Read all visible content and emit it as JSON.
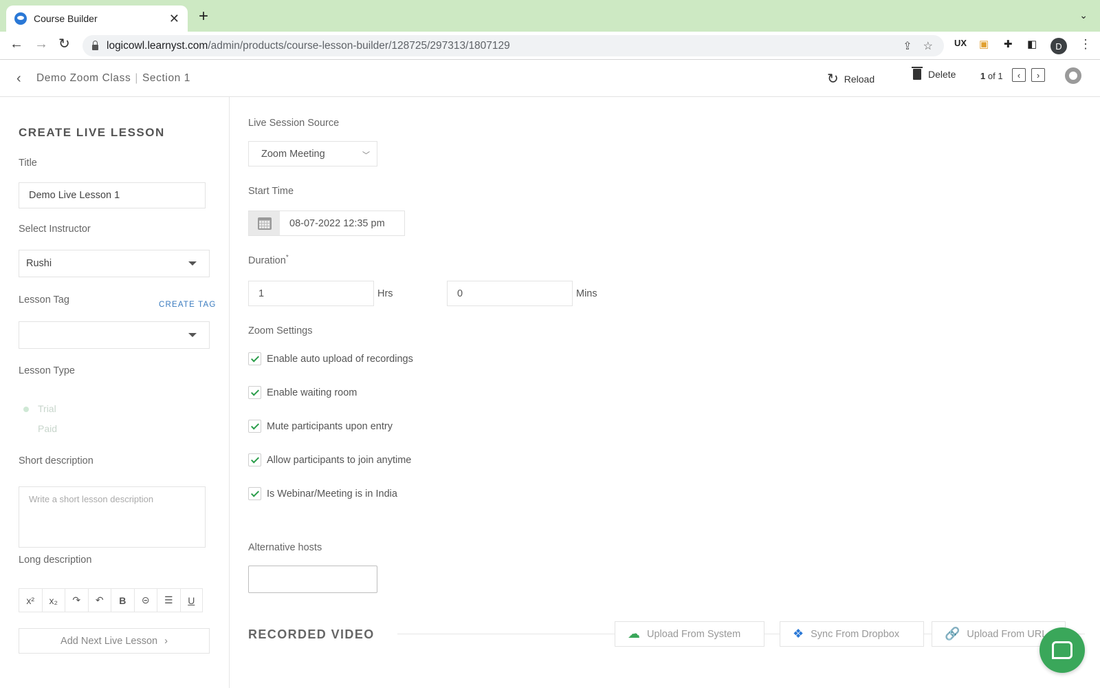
{
  "browser": {
    "tab_title": "Course Builder",
    "url_host": "logicowl.learnyst.com",
    "url_path": "/admin/products/course-lesson-builder/128725/297313/1807129",
    "profile_initial": "D",
    "ext_ux": "UX"
  },
  "header": {
    "course": "Demo Zoom Class",
    "section": "Section 1",
    "reload_label": "Reload",
    "delete_label": "Delete",
    "page_current": "1",
    "page_total": "of 1"
  },
  "left": {
    "panel_title": "CREATE LIVE LESSON",
    "title_label": "Title",
    "title_value": "Demo Live Lesson 1",
    "instructor_label": "Select Instructor",
    "instructor_value": "Rushi",
    "tag_label": "Lesson Tag",
    "create_tag": "CREATE TAG",
    "tag_value": "",
    "type_label": "Lesson Type",
    "type_options": [
      "Trial",
      "Paid"
    ],
    "short_desc_label": "Short description",
    "short_desc_placeholder": "Write a short lesson description",
    "long_desc_label": "Long description",
    "add_next": "Add Next Live Lesson",
    "rte_tools": [
      "x²",
      "x₂",
      "↷",
      "↶",
      "B",
      "⊝",
      "☰",
      "U"
    ]
  },
  "main": {
    "source_label": "Live Session Source",
    "source_value": "Zoom Meeting",
    "start_label": "Start Time",
    "start_value": "08-07-2022 12:35 pm",
    "duration_label": "Duration",
    "duration_required": "*",
    "hours_value": "1",
    "hours_unit": "Hrs",
    "mins_value": "0",
    "mins_unit": "Mins",
    "zoom_label": "Zoom Settings",
    "zoom_settings": [
      {
        "label": "Enable auto upload of recordings",
        "checked": true
      },
      {
        "label": "Enable waiting room",
        "checked": true
      },
      {
        "label": "Mute participants upon entry",
        "checked": true
      },
      {
        "label": "Allow participants to join anytime",
        "checked": true
      },
      {
        "label": "Is Webinar/Meeting is in India",
        "checked": true
      }
    ],
    "alt_hosts_label": "Alternative hosts",
    "recorded_title": "RECORDED VIDEO",
    "upload_system": "Upload From System",
    "sync_dropbox": "Sync From Dropbox",
    "upload_url": "Upload From URL"
  },
  "colors": {
    "tab_strip": "#cde9c3",
    "check": "#2a9d4a",
    "link": "#3a7bbf",
    "chat": "#3aa75a"
  }
}
